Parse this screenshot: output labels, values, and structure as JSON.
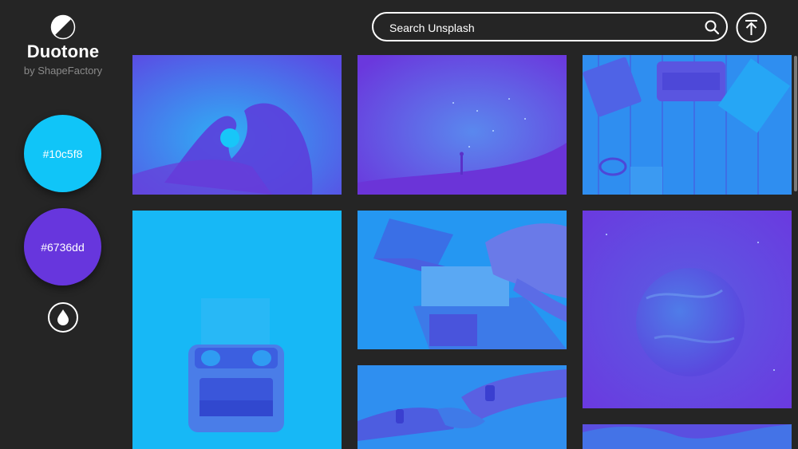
{
  "brand": {
    "title": "Duotone",
    "subtitle": "by ShapeFactory"
  },
  "palette": {
    "highlight": {
      "label": "#10c5f8",
      "color": "#10c5f8"
    },
    "shadow": {
      "label": "#6736dd",
      "color": "#6736dd"
    }
  },
  "search": {
    "placeholder": "Search Unsplash",
    "value": ""
  },
  "icons": {
    "logo": "half-circle-contrast-icon",
    "drop": "water-drop-icon",
    "search": "magnifier-icon",
    "top": "arrow-up-to-top-icon"
  },
  "photos": [
    {
      "subject": "heart-hands"
    },
    {
      "subject": "starry-sky"
    },
    {
      "subject": "typewriter-desk"
    },
    {
      "subject": "typewriter"
    },
    {
      "subject": "laptop-meeting"
    },
    {
      "subject": "planet"
    },
    {
      "subject": "hands-together"
    },
    {
      "subject": "partial-image"
    }
  ]
}
